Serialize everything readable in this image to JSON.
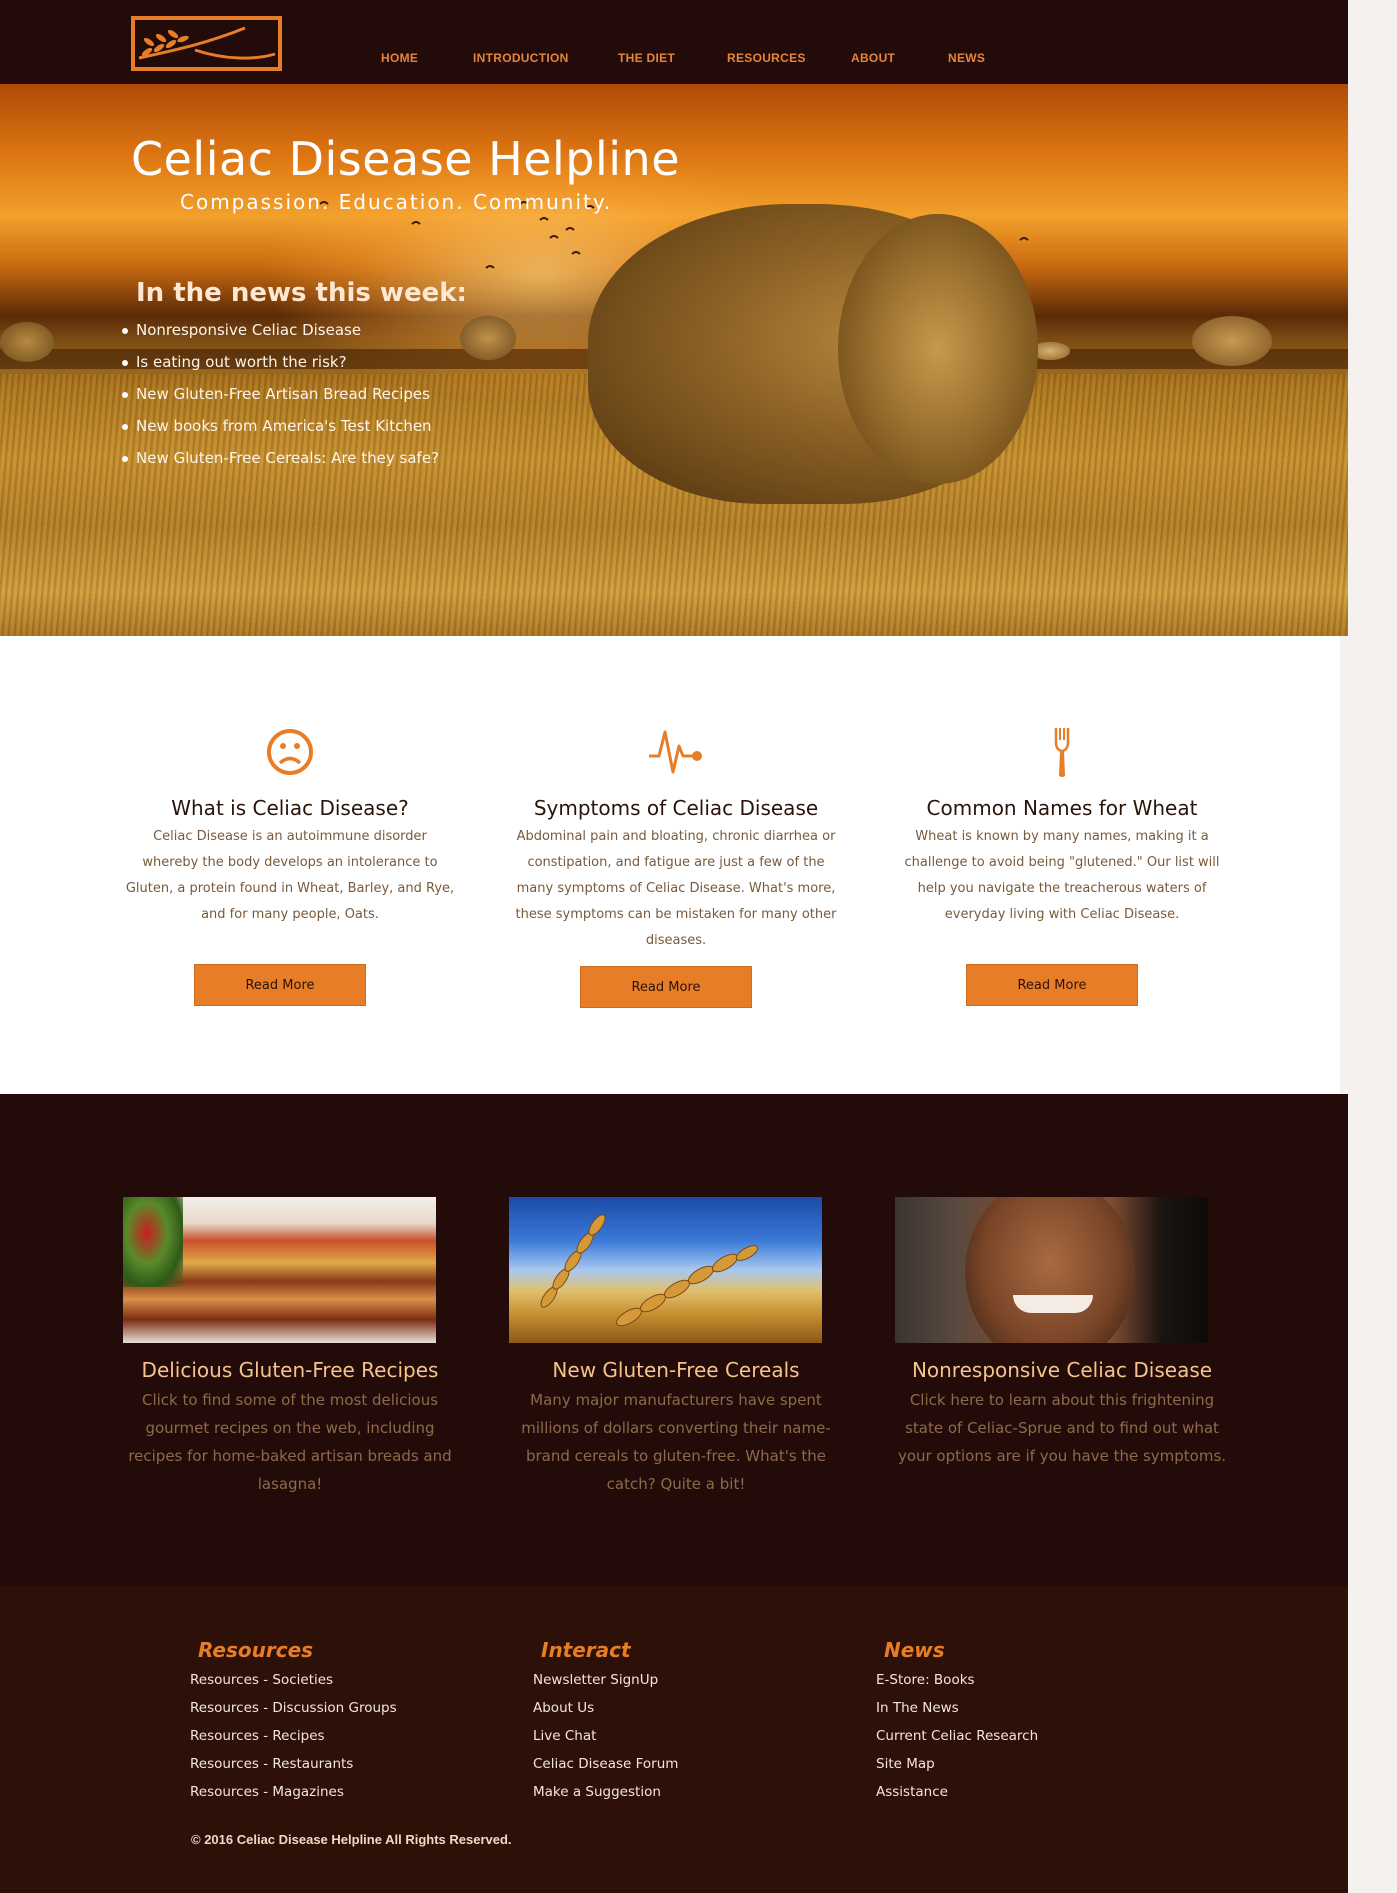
{
  "nav": {
    "items": [
      "HOME",
      "INTRODUCTION",
      "THE DIET",
      "RESOURCES",
      "ABOUT",
      "NEWS"
    ]
  },
  "hero": {
    "title": "Celiac Disease Helpline",
    "subtitle": "Compassion. Education. Community.",
    "news_heading": "In the news this week:",
    "news_items": [
      "Nonresponsive Celiac Disease",
      "Is eating out worth the risk?",
      "New Gluten-Free Artisan Bread Recipes",
      "New books from America's Test Kitchen",
      "New Gluten-Free Cereals: Are they safe?"
    ]
  },
  "info": [
    {
      "icon": "sad-face-icon",
      "title": "What is Celiac Disease?",
      "text": "Celiac Disease is an autoimmune disorder whereby the body develops an intolerance to Gluten, a protein found in Wheat, Barley, and Rye, and for many people, Oats.",
      "button": "Read More"
    },
    {
      "icon": "heartbeat-icon",
      "title": "Symptoms of Celiac Disease",
      "text": "Abdominal pain and bloating, chronic diarrhea or constipation, and fatigue are just a few of the many symptoms of Celiac Disease. What's more, these symptoms can be mistaken for many other diseases.",
      "button": "Read More"
    },
    {
      "icon": "fork-icon",
      "title": "Common Names for Wheat",
      "text": "Wheat is known by many names, making it a challenge to avoid being \"glutened.\" Our list will help you navigate the treacherous waters of everyday living with Celiac Disease.",
      "button": "Read More"
    }
  ],
  "features": [
    {
      "title": "Delicious Gluten-Free Recipes",
      "text": "Click to find some of the most delicious gourmet recipes on the web, including recipes for home-baked artisan breads and lasagna!"
    },
    {
      "title": "New Gluten-Free Cereals",
      "text": "Many major manufacturers have spent millions of dollars converting their name-brand cereals to gluten-free. What's the catch? Quite a bit!"
    },
    {
      "title": "Nonresponsive Celiac Disease",
      "text": "Click here to learn about this frightening state of Celiac-Sprue and to find out what your options are if you have the symptoms."
    }
  ],
  "footer": {
    "groups": [
      {
        "title": "Resources",
        "links": [
          "Resources - Societies",
          "Resources - Discussion Groups",
          "Resources - Recipes",
          "Resources - Restaurants",
          "Resources - Magazines"
        ]
      },
      {
        "title": "Interact",
        "links": [
          "Newsletter SignUp",
          "About Us",
          "Live Chat",
          "Celiac Disease Forum",
          "Make a Suggestion"
        ]
      },
      {
        "title": "News",
        "links": [
          "E-Store: Books",
          "In The News",
          "Current Celiac Research",
          "Site Map",
          "Assistance"
        ]
      }
    ],
    "copyright": "© 2016 Celiac Disease Helpline All Rights Reserved."
  },
  "colors": {
    "accent": "#e87d28",
    "dark_bg": "#220b08",
    "footer_bg": "#2d1108"
  }
}
